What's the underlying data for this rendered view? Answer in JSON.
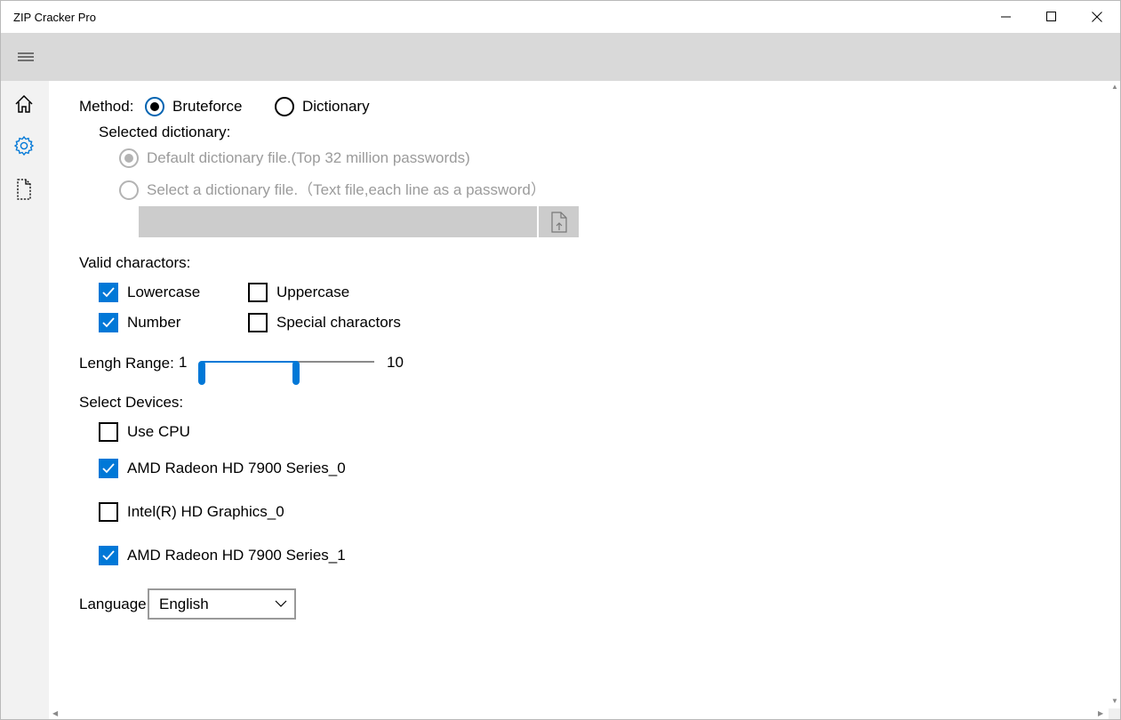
{
  "window": {
    "title": "ZIP Cracker Pro"
  },
  "nav": {
    "items": [
      "home-icon",
      "gear-icon",
      "document-icon"
    ],
    "selected": "gear-icon",
    "accent": "#0078d7"
  },
  "method": {
    "label": "Method:",
    "options": [
      {
        "label": "Bruteforce",
        "selected": true
      },
      {
        "label": "Dictionary",
        "selected": false
      }
    ]
  },
  "dictionary": {
    "label": "Selected dictionary:",
    "options": [
      {
        "label": "Default dictionary file.(Top 32 million passwords)",
        "selected": true
      },
      {
        "label": "Select a dictionary file.（Text file,each line as a password）",
        "selected": false
      }
    ],
    "file_path": ""
  },
  "charset": {
    "label": "Valid charactors:",
    "options": [
      {
        "label": "Lowercase",
        "checked": true
      },
      {
        "label": "Uppercase",
        "checked": false
      },
      {
        "label": "Number",
        "checked": true
      },
      {
        "label": "Special charactors",
        "checked": false
      }
    ]
  },
  "length": {
    "label": "Lengh Range:",
    "min_label": "1",
    "max_label": "10",
    "low_value": 1,
    "high_value": 6,
    "scale_min": 1,
    "scale_max": 10
  },
  "devices": {
    "label": "Select Devices:",
    "items": [
      {
        "label": "Use CPU",
        "checked": false
      },
      {
        "label": "AMD Radeon HD 7900 Series_0",
        "checked": true
      },
      {
        "label": "Intel(R) HD Graphics_0",
        "checked": false
      },
      {
        "label": "AMD Radeon HD 7900 Series_1",
        "checked": true
      }
    ]
  },
  "language": {
    "label": "Language:",
    "value": "English"
  }
}
